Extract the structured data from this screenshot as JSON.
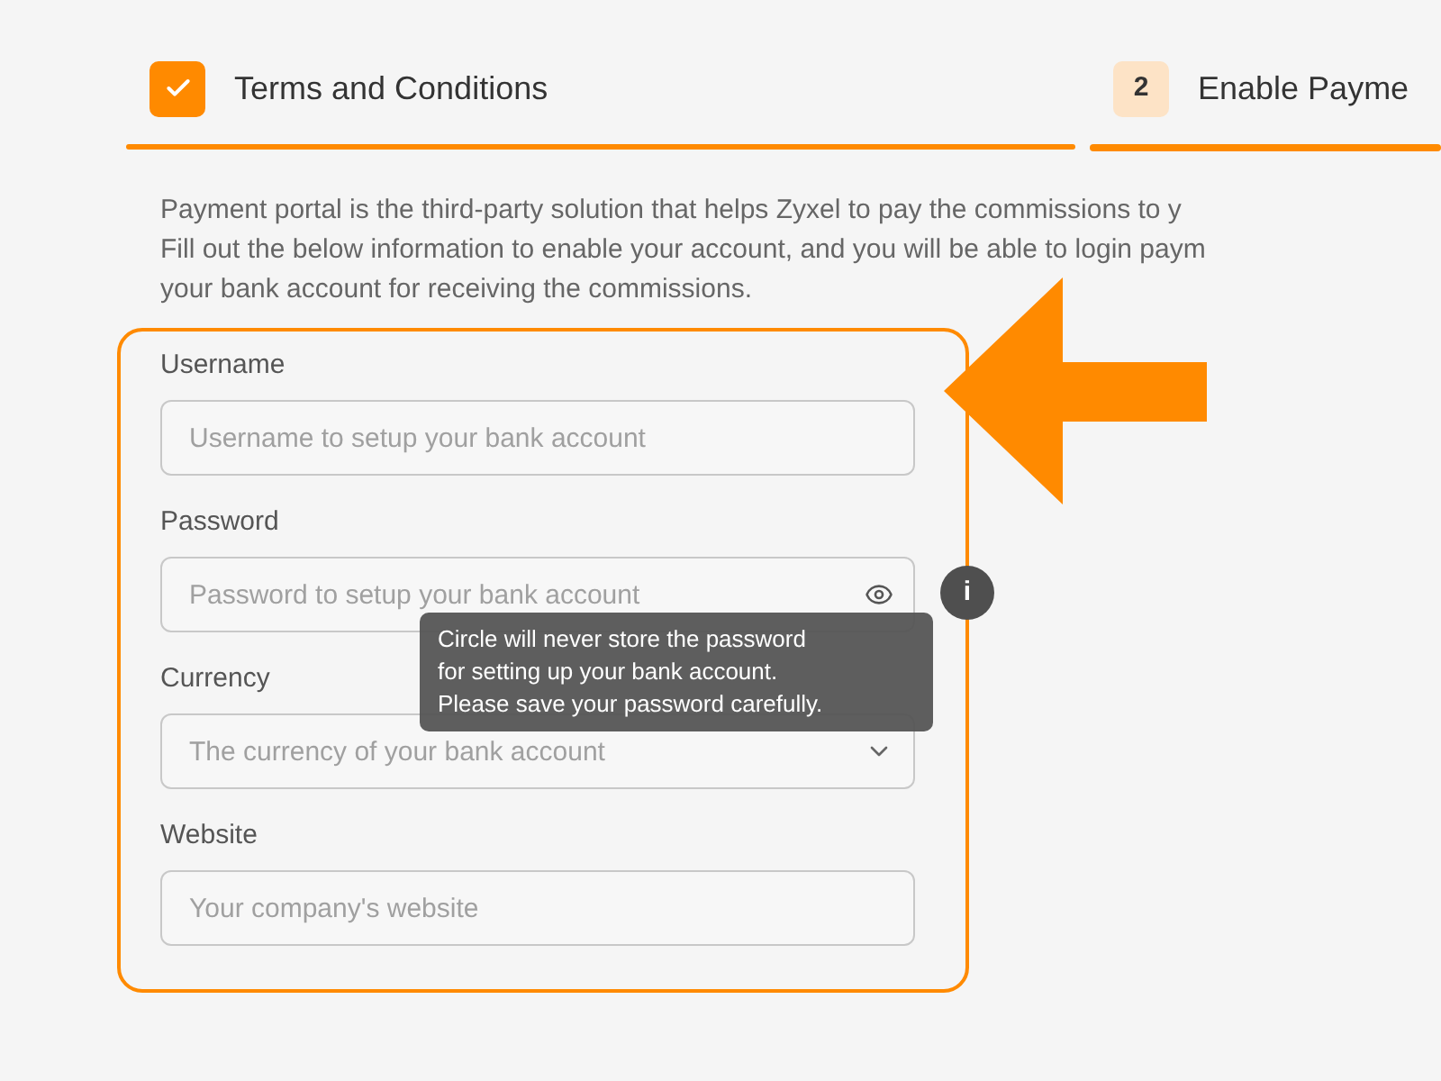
{
  "steps": [
    {
      "kind": "done",
      "label": "Terms and Conditions",
      "selected": false
    },
    {
      "kind": "number",
      "number": "2",
      "label": "Enable Payme",
      "selected": true
    }
  ],
  "intro": [
    "Payment portal is the third-party solution that helps Zyxel to pay the commissions to y",
    "Fill out the below information to enable your account, and you will be able to login paym",
    "your bank account for receiving the commissions."
  ],
  "form": {
    "fields": [
      {
        "kind": "text",
        "label": "Username",
        "placeholder": "Username to setup your bank account"
      },
      {
        "kind": "password",
        "label": "Password",
        "placeholder": "Password to setup your bank account",
        "info": "i"
      },
      {
        "kind": "select",
        "label": "Currency",
        "placeholder": "The currency of your bank account"
      },
      {
        "kind": "text",
        "label": "Website",
        "placeholder": "Your company's website"
      }
    ]
  },
  "tooltip": {
    "lines": [
      "Circle will never store the password",
      "for setting up your bank account.",
      "Please save your password carefully."
    ]
  }
}
